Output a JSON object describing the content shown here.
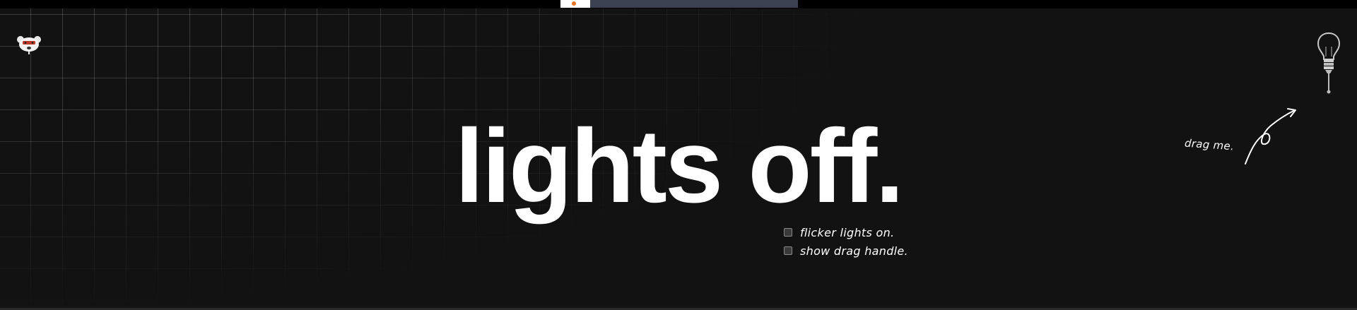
{
  "headline": "lights off.",
  "options": [
    {
      "label": "flicker lights on.",
      "checked": false
    },
    {
      "label": "show drag handle.",
      "checked": false
    }
  ],
  "drag_hint": "drag me.",
  "icons": {
    "logo": "bear-logo-icon",
    "bulb": "lightbulb-icon",
    "arrow": "curly-arrow-icon"
  },
  "colors": {
    "background": "#121212",
    "text": "#ffffff",
    "grid": "rgba(255,255,255,0.18)",
    "logo_accent": "#c0392b",
    "top_tab": "#3b4150"
  }
}
